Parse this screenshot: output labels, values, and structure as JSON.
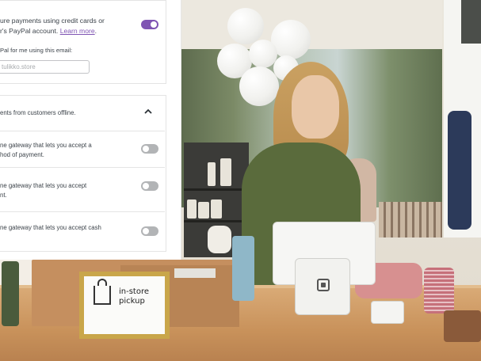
{
  "payments_panel": {
    "card_payments": {
      "description_text": "ure payments using credit cards or",
      "description_text_2": "r's PayPal account. ",
      "learn_more_label": "Learn more",
      "learn_more_suffix": ".",
      "enabled": true,
      "email_label": "Pal for me using this email:",
      "email_placeholder": "tulikko.store"
    },
    "offline_section": {
      "title": "ents from customers offline.",
      "expanded": true,
      "items": [
        {
          "line1": "ne gateway that lets you accept a",
          "line2": "hod of payment.",
          "enabled": false
        },
        {
          "line1": "ne gateway that lets you accept",
          "line2": "nt.",
          "enabled": false
        },
        {
          "line1": "ne gateway that lets you accept cash",
          "line2": "",
          "enabled": false
        }
      ]
    },
    "accent_color": "#7f54b3"
  },
  "photo": {
    "sign_line1": "in-store",
    "sign_line2": "pickup",
    "terminal_logo": "square-logo-icon",
    "bag_icon": "shopping-bag-icon"
  }
}
